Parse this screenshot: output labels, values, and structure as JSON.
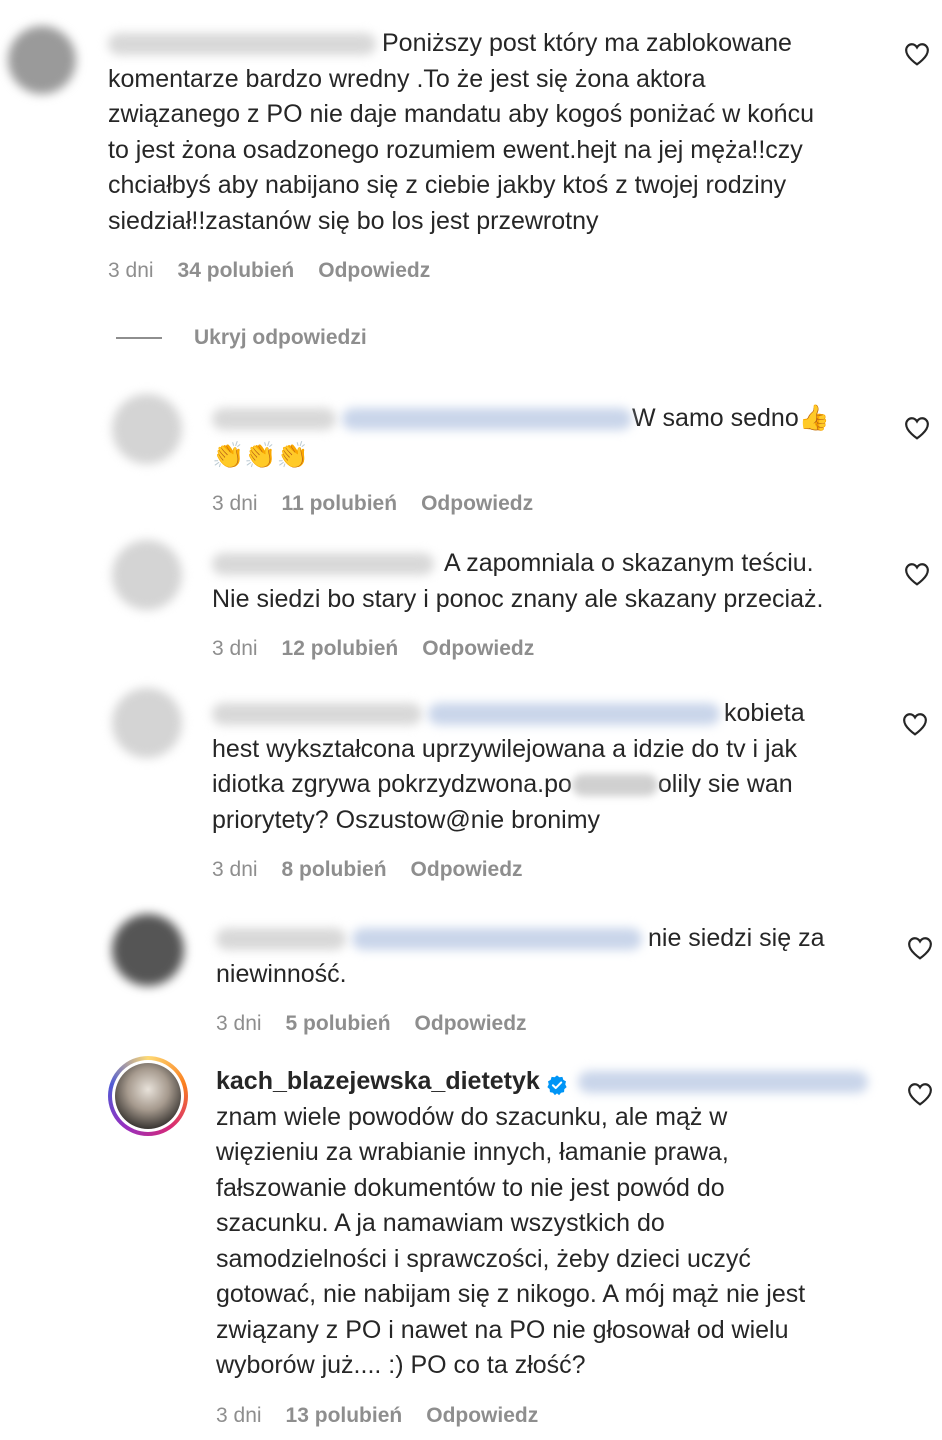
{
  "comments": [
    {
      "text": "Poniższy post który ma zablokowane\nkomentarze bardzo wredny .To że jest się żona aktora\nzwiązanego z PO nie daje mandatu aby kogoś poniżać w końcu\nto jest żona osadzonego rozumiem ewent.hejt na jej męża!!czy\nchciałbyś aby nabijano się z ciebie jakby ktoś z twojej rodziny\nsiedział!!zastanów się bo los jest przewrotny",
      "time": "3 dni",
      "likes": "34 polubień",
      "reply": "Odpowiedz"
    },
    {
      "text_after_mention": "W samo sedno👍",
      "emoji_line": "👏👏👏",
      "time": "3 dni",
      "likes": "11 polubień",
      "reply": "Odpowiedz"
    },
    {
      "text_first": "A zapomniala o skazanym teściu.",
      "text_rest": "Nie siedzi bo stary i ponoc znany ale skazany przeciaż.",
      "time": "3 dni",
      "likes": "12 polubień",
      "reply": "Odpowiedz"
    },
    {
      "text_first": "kobieta",
      "text_rest_1": "hest wykształcona uprzywilejowana a idzie do tv i jak",
      "text_rest_2a": "idiotka zgrywa pokrzydzwona.po",
      "text_rest_2b": "olily sie wan",
      "text_rest_3": "priorytety? Oszustow@nie bronimy",
      "time": "3 dni",
      "likes": "8 polubień",
      "reply": "Odpowiedz"
    },
    {
      "text_first": "nie siedzi się za",
      "text_rest": "niewinność.",
      "time": "3 dni",
      "likes": "5 polubień",
      "reply": "Odpowiedz"
    },
    {
      "username": "kach_blazejewska_dietetyk",
      "text": "znam wiele powodów do szacunku, ale mąż w\nwięzieniu za wrabianie innych, łamanie prawa,\nfałszowanie dokumentów to nie jest powód do\nszacunku. A ja namawiam wszystkich do\nsamodzielności i sprawczości, żeby dzieci uczyć\ngotować, nie nabijam się z nikogo. A mój mąż nie jest\nzwiązany z PO i nawet na PO nie głosował od wielu\nwyborów już.... :) PO co ta złość?",
      "time": "3 dni",
      "likes": "13 polubień",
      "reply": "Odpowiedz"
    }
  ],
  "hide_replies": "Ukryj odpowiedzi",
  "icons": {
    "like": "heart-outline-icon",
    "verified": "verified-badge-icon"
  },
  "colors": {
    "text": "#262626",
    "meta": "#8e8e8e",
    "verified": "#0095f6"
  }
}
